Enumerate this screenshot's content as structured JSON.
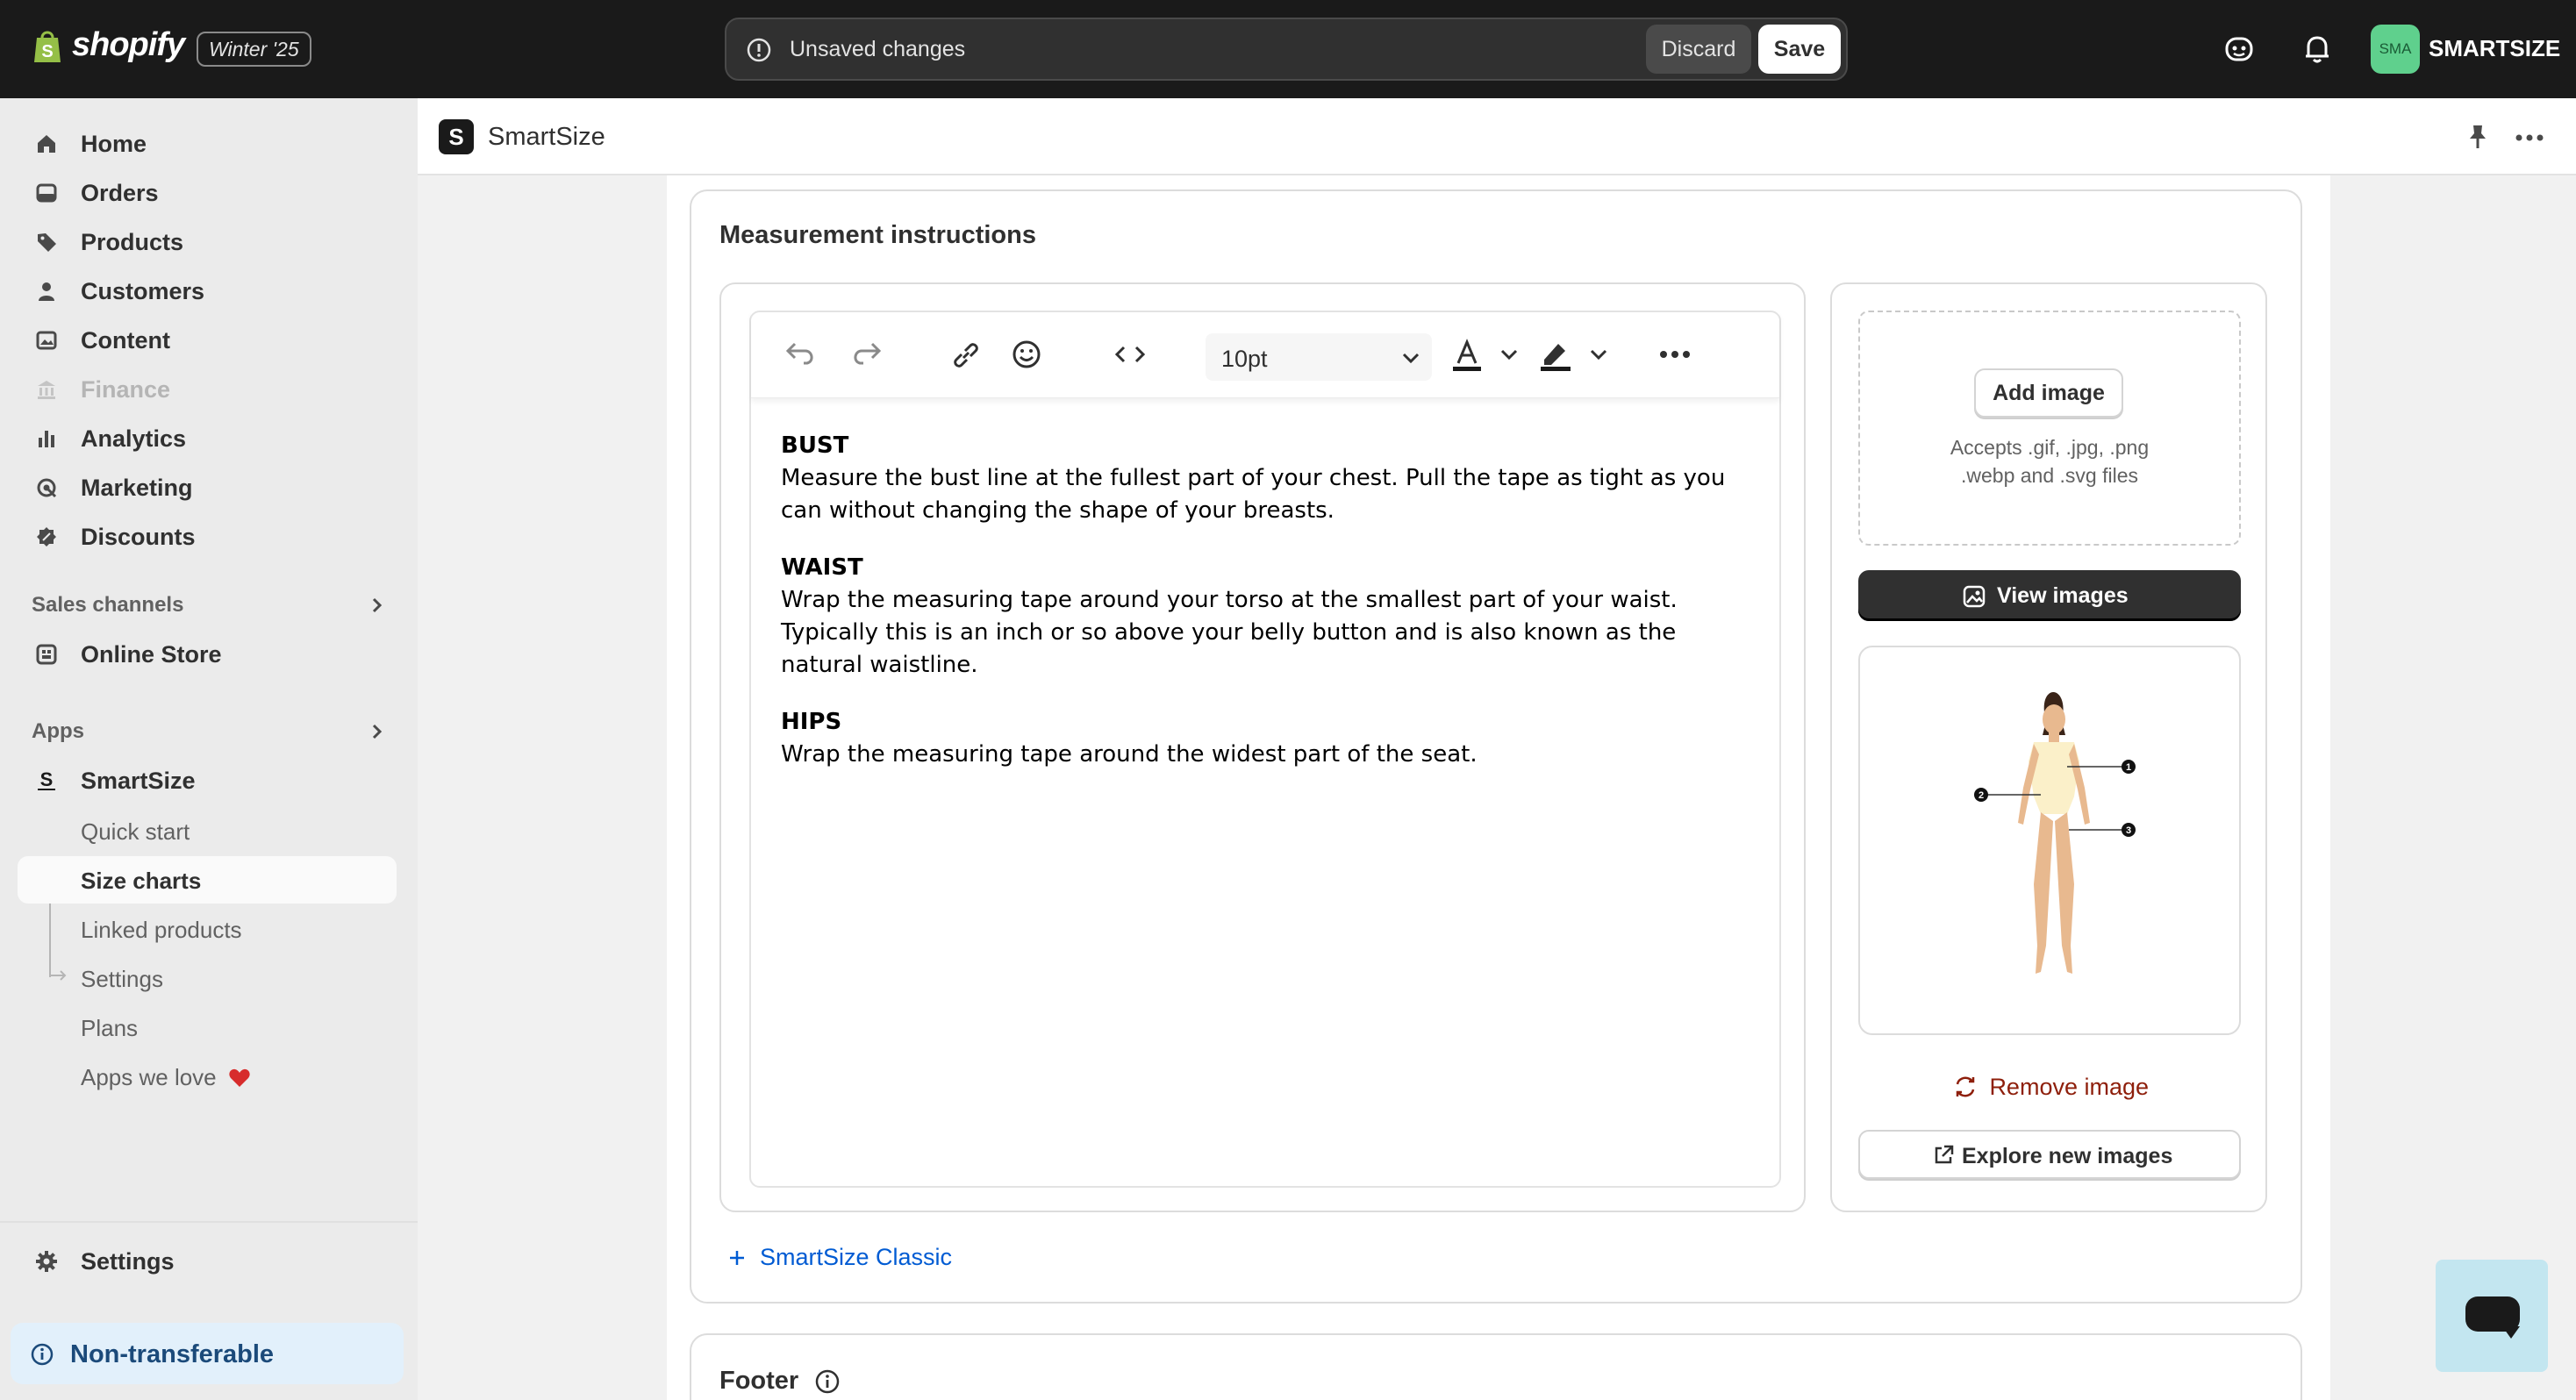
{
  "topbar": {
    "brand": "shopify",
    "edition": "Winter '25",
    "unsaved_message": "Unsaved changes",
    "discard_label": "Discard",
    "save_label": "Save",
    "avatar_initials": "SMA",
    "store_name": "SMARTSIZE"
  },
  "sidebar": {
    "main": [
      "Home",
      "Orders",
      "Products",
      "Customers",
      "Content",
      "Finance",
      "Analytics",
      "Marketing",
      "Discounts"
    ],
    "sales_channels_heading": "Sales channels",
    "online_store": "Online Store",
    "apps_heading": "Apps",
    "app_name": "SmartSize",
    "app_items": [
      "Quick start",
      "Size charts",
      "Linked products",
      "Settings",
      "Plans",
      "Apps we love"
    ],
    "active_item": "Size charts",
    "settings": "Settings",
    "non_transferable": "Non-transferable"
  },
  "app_header": {
    "logo_letter": "S",
    "title": "SmartSize"
  },
  "measurement": {
    "title": "Measurement instructions",
    "font_size": "10pt",
    "content": [
      {
        "heading": "BUST",
        "text": "Measure the bust line at the fullest part of your chest. Pull the tape as tight as you can without changing the shape of your breasts."
      },
      {
        "heading": "WAIST",
        "text": "Wrap the measuring tape around your torso at the smallest part of your waist. Typically this is an inch or so above your belly button and is also known as the natural waistline."
      },
      {
        "heading": "HIPS",
        "text": "Wrap the measuring tape around the widest part of the seat."
      }
    ],
    "add_image_label": "Add image",
    "accepts_line1": "Accepts .gif, .jpg, .png",
    "accepts_line2": ".webp and .svg files",
    "view_images_label": "View images",
    "diagram_markers": [
      "1",
      "2",
      "3"
    ],
    "remove_image_label": "Remove image",
    "explore_label": "Explore new images",
    "add_classic_label": "SmartSize Classic"
  },
  "footer": {
    "title": "Footer"
  },
  "colors": {
    "topbar": "#1a1a1a",
    "link": "#005bd3",
    "critical": "#8e1f0b",
    "avatar": "#5fd08d"
  }
}
